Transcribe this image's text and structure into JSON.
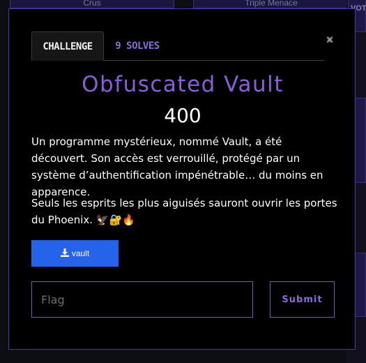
{
  "background": {
    "card_left_label": "Crus",
    "card_right_label": "Triple Menace",
    "side_label": "VOT"
  },
  "modal": {
    "close_glyph": "×",
    "tabs": [
      {
        "label": "CHALLENGE",
        "active": true
      },
      {
        "label": "9 SOLVES",
        "active": false
      }
    ],
    "title": "Obfuscated Vault",
    "points": "400",
    "description": [
      "Un programme mystérieux, nommé Vault, a été découvert. Son accès est verrouillé, protégé par un système d’authentification impénétrable… du moins en apparence.",
      "Seuls les esprits les plus aiguisés sauront ouvrir les portes du Phoenix. 🦅🔐🔥"
    ],
    "download": {
      "icon": "download-icon",
      "label": "vault"
    },
    "flag_input": {
      "placeholder": "Flag",
      "value": ""
    },
    "submit_label": "Submit"
  },
  "colors": {
    "accent": "#8a5fd6",
    "download_button": "#2563eb",
    "modal_border": "#4b3aa6"
  }
}
